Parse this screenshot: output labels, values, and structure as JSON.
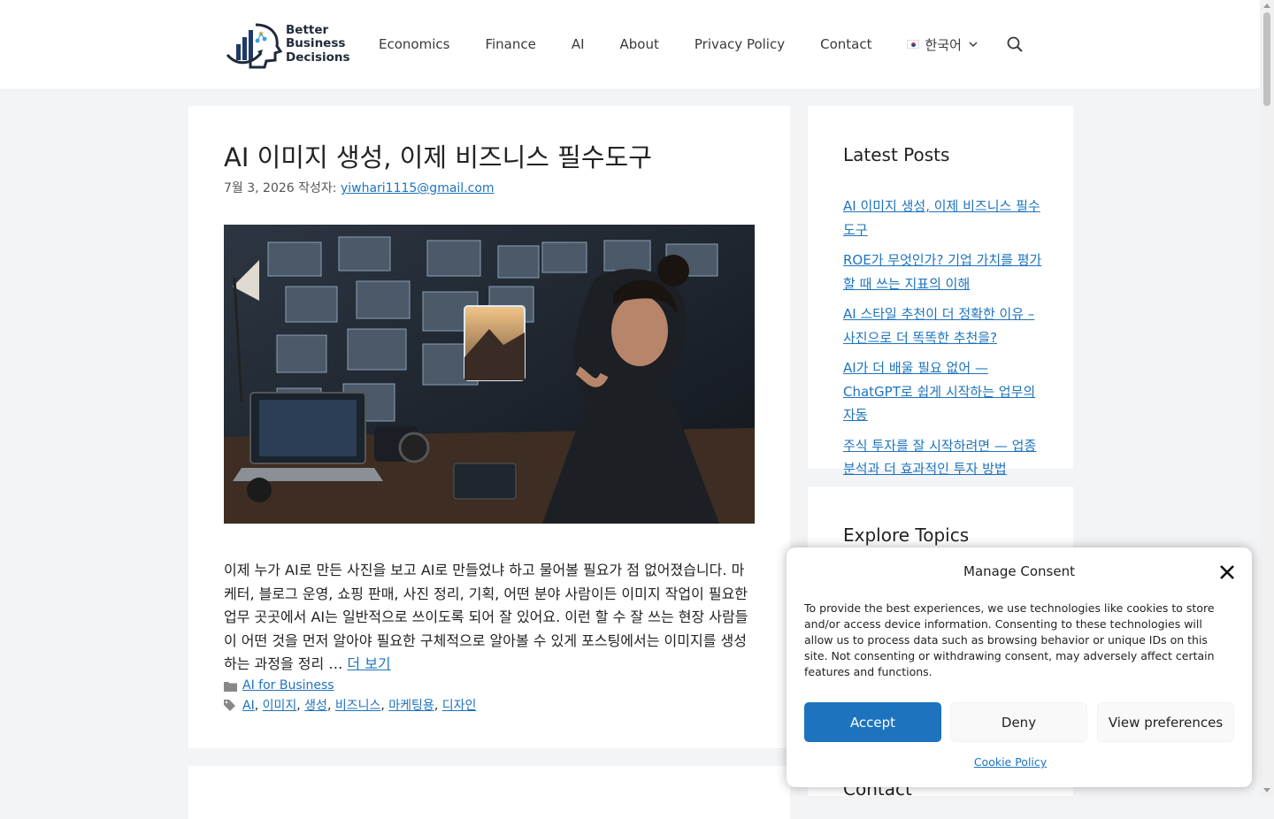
{
  "header": {
    "logo": {
      "lines": [
        "Better",
        "Business",
        "Decisions"
      ]
    },
    "nav": [
      "Economics",
      "Finance",
      "AI",
      "About",
      "Privacy Policy",
      "Contact"
    ],
    "language": {
      "label": "한국어",
      "flag": "kr-flag-icon"
    },
    "search_icon": "search-icon"
  },
  "post": {
    "title": "AI 이미지 생성, 이제 비즈니스 필수도구",
    "date": "7월 3, 2026",
    "author_prefix": "작성자:",
    "author": "yiwhari1115@gmail.com",
    "image_alt": "Woman at a desk with a laptop and camera, looking at floating AI-generated image panels",
    "excerpt": "이제 누가 AI로 만든 사진을 보고 AI로 만들었냐 하고 물어볼 필요가 점 없어졌습니다. 마케터, 블로그 운영, 쇼핑 판매, 사진 정리, 기획, 어떤 분야 사람이든 이미지 작업이 필요한 업무 곳곳에서 AI는 일반적으로 쓰이도록 되어 잘 있어요. 이런 할 수 잘 쓰는 현장 사람들이 어떤 것을 먼저 알아야 필요한 구체적으로 알아볼 수 있게 포스팅에서는 이미지를 생성하는 과정을 정리",
    "ellipsis": "…",
    "more_link": "더 보기",
    "category_icon": "folder-icon",
    "category": "AI for Business",
    "tags_icon": "tags-icon",
    "tags": [
      "AI",
      "이미지",
      "생성",
      "비즈니스",
      "마케팅용",
      "디자인"
    ]
  },
  "sidebar": {
    "latest": {
      "title": "Latest Posts",
      "items": [
        "AI 이미지 생성, 이제 비즈니스 필수도구",
        "ROE가 무엇인가? 기업 가치를 평가 할 때 쓰는 지표의 이해",
        "AI 스타일 추천이 더 정확한 이유 – 사진으로 더 똑똑한 추천을?",
        "AI가 더 배울 필요 없어 — ChatGPT로 쉽게 시작하는 업무의 자동",
        "주식 투자를 잘 시작하려면 — 업종 분석과 더 효과적인 투자 방법"
      ]
    },
    "explore_title": "Explore Topics",
    "contact_title": "Contact"
  },
  "consent": {
    "title": "Manage Consent",
    "body": "To provide the best experiences, we use technologies like cookies to store and/or access device information. Consenting to these technologies will allow us to process data such as browsing behavior or unique IDs on this site. Not consenting or withdrawing consent, may adversely affect certain features and functions.",
    "accept": "Accept",
    "deny": "Deny",
    "preferences": "View preferences",
    "policy_link": "Cookie Policy"
  },
  "colors": {
    "accent": "#1e73be",
    "page_bg": "#f3f4f6",
    "card_bg": "#ffffff"
  }
}
